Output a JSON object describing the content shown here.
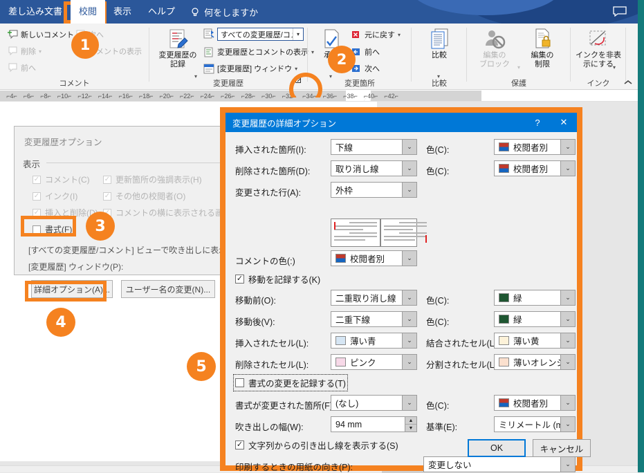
{
  "window": {
    "tabs": [
      {
        "label": "差し込み文書",
        "active": false
      },
      {
        "label": "校閲",
        "active": true
      },
      {
        "label": "表示",
        "active": false
      },
      {
        "label": "ヘルプ",
        "active": false
      }
    ],
    "tell_me": "何をしますか",
    "comment_icon": "comment-bubble-icon",
    "bulb_icon": "lightbulb-icon"
  },
  "ribbon": {
    "groups": [
      {
        "name": "コメント"
      },
      {
        "name": "変更履歴"
      },
      {
        "name": "変更箇所"
      },
      {
        "name": "比較"
      },
      {
        "name": "保護"
      },
      {
        "name": "インク"
      }
    ],
    "comment_group": {
      "new_comment": "新しいコメント",
      "delete": "削除",
      "prev": "前へ",
      "next": "次へ",
      "show_comments": "コメントの表示"
    },
    "track_group": {
      "track_changes": "変更履歴の\n記録",
      "track_changes_l1": "変更履歴の",
      "track_changes_l2": "記録",
      "display_for_review_value": "すべての変更履歴/コメ…",
      "show_markup": "変更履歴とコメントの表示",
      "reviewing_pane": "[変更履歴] ウィンドウ",
      "dialog_launcher": "dialog-box-launcher"
    },
    "changes_group": {
      "accept_l1": "承諾",
      "undo": "元に戻す",
      "prev": "前へ",
      "next": "次へ"
    },
    "compare_group": {
      "compare": "比較"
    },
    "protect_group": {
      "block_authors_l1": "編集の",
      "block_authors_l2": "ブロック",
      "restrict_l1": "編集の",
      "restrict_l2": "制限"
    },
    "ink_group": {
      "hide_ink_l1": "インクを非表",
      "hide_ink_l2": "示にする"
    },
    "collapse": "⌃"
  },
  "ruler": {
    "ticks": [
      "4",
      "6",
      "8",
      "10",
      "12",
      "14",
      "16",
      "18",
      "20",
      "22",
      "24",
      "26",
      "28",
      "30",
      "32",
      "34",
      "36",
      "38",
      "40",
      "42"
    ]
  },
  "bg_dialog": {
    "title": "変更履歴オプション",
    "section_display": "表示",
    "checkboxes": [
      {
        "label": "コメント(C)",
        "checked": true,
        "enabled": false
      },
      {
        "label": "更新箇所の強調表示(H)",
        "checked": true,
        "enabled": false
      },
      {
        "label": "インク(I)",
        "checked": true,
        "enabled": false
      },
      {
        "label": "その他の校閲者(O)",
        "checked": true,
        "enabled": false
      },
      {
        "label": "挿入と削除(D)",
        "checked": true,
        "enabled": false
      },
      {
        "label": "コメントの横に表示される画像(T)",
        "checked": true,
        "enabled": false
      },
      {
        "label": "書式(F)",
        "checked": false,
        "enabled": true
      }
    ],
    "text1": "[すべての変更履歴/コメント] ビューで吹き出しに表示する内",
    "text2": "[変更履歴] ウィンドウ(P):",
    "advanced_button": "詳細オプション(A)...",
    "change_user_button": "ユーザー名の変更(N)..."
  },
  "fg_dialog": {
    "title": "変更履歴の詳細オプション",
    "help_icon": "?",
    "close_icon": "✕",
    "rows": [
      {
        "label": "挿入された箇所(I):",
        "value": "下線",
        "color_label": "色(C):",
        "color_value": "校閲者別",
        "swatch": "reviewer"
      },
      {
        "label": "削除された箇所(D):",
        "value": "取り消し線",
        "color_label": "色(C):",
        "color_value": "校閲者別",
        "swatch": "reviewer"
      },
      {
        "label": "変更された行(A):",
        "value": "外枠"
      }
    ],
    "comment_color_label": "コメントの色(:)",
    "comment_color_value": "校閲者別",
    "track_moves": {
      "label": "移動を記録する(K)",
      "checked": true
    },
    "moved_from": {
      "label": "移動前(O):",
      "value": "二重取り消し線",
      "color_label": "色(C):",
      "color_value": "緑",
      "swatch": "#1e5631"
    },
    "moved_to": {
      "label": "移動後(V):",
      "value": "二重下線",
      "color_label": "色(C):",
      "color_value": "緑",
      "swatch": "#1e5631"
    },
    "inserted_cells": {
      "label": "挿入されたセル(L):",
      "value": "薄い青",
      "swatch": "#d6e6f4"
    },
    "merged_cells": {
      "label": "結合されたセル(L):",
      "value": "薄い黄",
      "swatch": "#fdf2d9"
    },
    "deleted_cells": {
      "label": "削除されたセル(L):",
      "value": "ピンク",
      "swatch": "#f7d9e8"
    },
    "split_cells": {
      "label": "分割されたセル(L):",
      "value": "薄いオレンジ",
      "swatch": "#fbe0ce"
    },
    "track_formatting": {
      "label": "書式の変更を記録する(T)",
      "checked": false
    },
    "formatting": {
      "label": "書式が変更された箇所(F):",
      "value": "(なし)",
      "color_label": "色(C):",
      "color_value": "校閲者別",
      "swatch": "reviewer"
    },
    "balloon_width": {
      "label": "吹き出しの幅(W):",
      "value": "94 mm"
    },
    "measure": {
      "label": "基準(E):",
      "value": "ミリメートル (mm)"
    },
    "show_lines": {
      "label": "文字列からの引き出し線を表示する(S)",
      "checked": true
    },
    "paper_orientation": {
      "label": "印刷するときの用紙の向き(P):",
      "value": "変更しない"
    },
    "ok": "OK",
    "cancel": "キャンセル"
  },
  "annotations": {
    "accent": "#f58220",
    "steps": [
      {
        "n": "1"
      },
      {
        "n": "2"
      },
      {
        "n": "3"
      },
      {
        "n": "4"
      },
      {
        "n": "5"
      }
    ]
  }
}
